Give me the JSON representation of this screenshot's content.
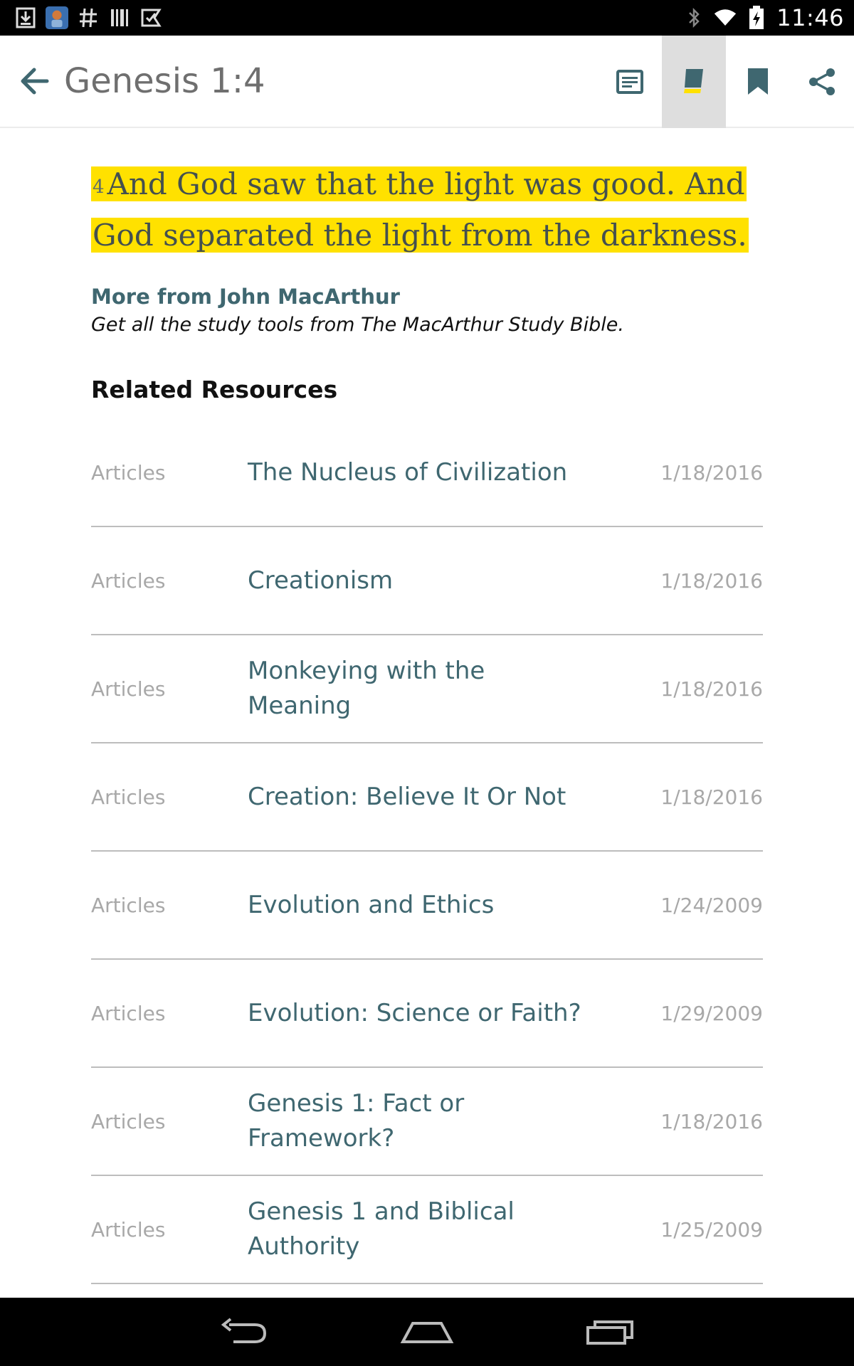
{
  "status_bar": {
    "time": "11:46",
    "left_icons": [
      "download-icon",
      "app-notification-icon",
      "hashtag-icon",
      "barcode-icon",
      "checklist-icon"
    ],
    "right_icons": [
      "bluetooth-icon",
      "wifi-icon",
      "battery-charging-icon"
    ]
  },
  "app_bar": {
    "title": "Genesis 1:4",
    "actions": [
      {
        "icon": "notes-icon",
        "selected": false
      },
      {
        "icon": "highlighter-icon",
        "selected": true
      },
      {
        "icon": "bookmark-icon",
        "selected": false
      },
      {
        "icon": "share-icon",
        "selected": false
      }
    ]
  },
  "verse": {
    "number": "4",
    "text": "And God saw that the light was good. And God separated the light from the darkness.",
    "highlight_color": "#ffe100"
  },
  "promo": {
    "link": "More from John MacArthur",
    "description": "Get all the study tools from The MacArthur Study Bible."
  },
  "related": {
    "heading": "Related Resources",
    "items": [
      {
        "category": "Articles",
        "title": "The Nucleus of Civilization",
        "date": "1/18/2016"
      },
      {
        "category": "Articles",
        "title": "Creationism",
        "date": "1/18/2016"
      },
      {
        "category": "Articles",
        "title": "Monkeying with the Meaning",
        "date": "1/18/2016"
      },
      {
        "category": "Articles",
        "title": "Creation: Believe It Or Not",
        "date": "1/18/2016"
      },
      {
        "category": "Articles",
        "title": "Evolution and Ethics",
        "date": "1/24/2009"
      },
      {
        "category": "Articles",
        "title": "Evolution: Science or Faith?",
        "date": "1/29/2009"
      },
      {
        "category": "Articles",
        "title": "Genesis 1: Fact or Framework?",
        "date": "1/18/2016"
      },
      {
        "category": "Articles",
        "title": "Genesis 1 and Biblical Authority",
        "date": "1/25/2009"
      }
    ]
  },
  "nav_bar": {
    "buttons": [
      "back-icon",
      "home-icon",
      "recent-apps-icon"
    ]
  },
  "colors": {
    "accent": "#3f6770",
    "highlight": "#ffe100",
    "muted": "#a8a8a8"
  }
}
